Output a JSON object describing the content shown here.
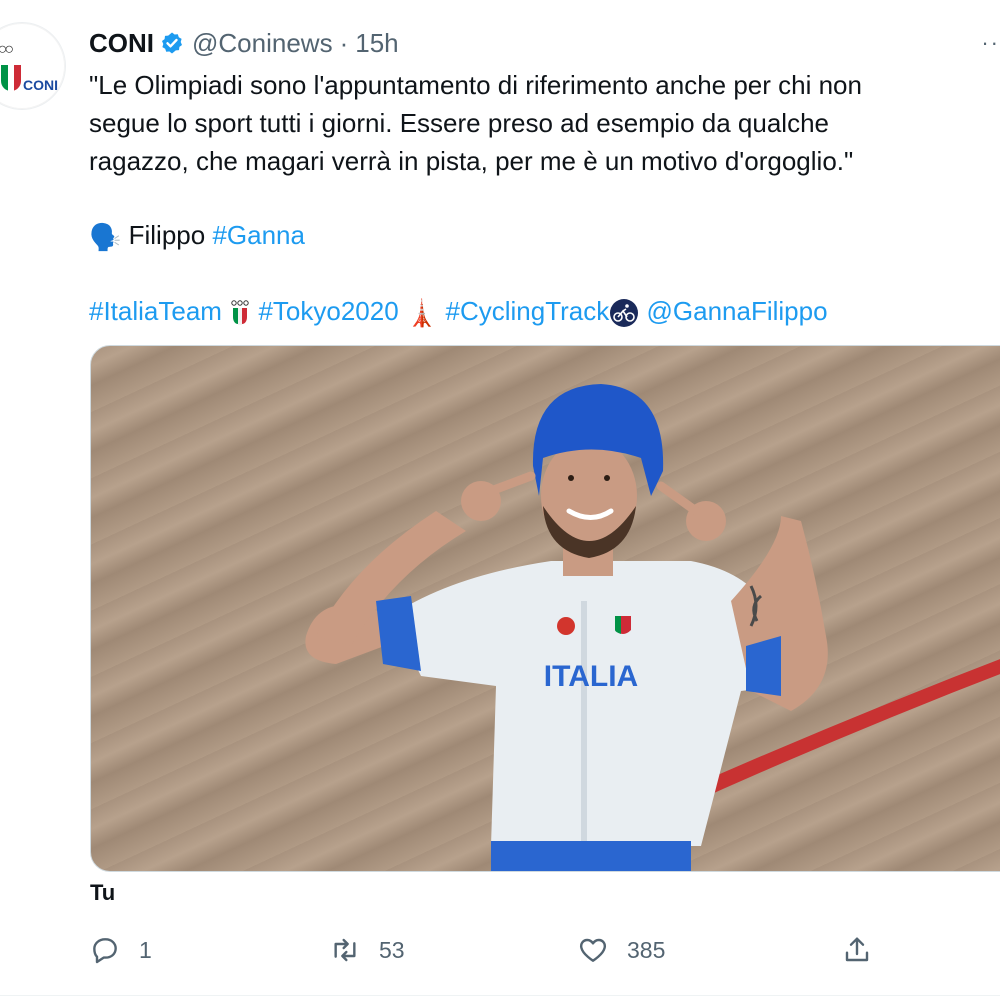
{
  "tweet": {
    "author_name": "CONI",
    "avatar_text": "CONI",
    "handle": "@Coninews",
    "separator": "·",
    "time": "15h",
    "lines": [
      "\"Le Olimpiadi sono l'appuntamento di riferimento anche per chi non",
      "segue lo sport tutti i giorni. Essere preso ad esempio da qualche",
      "ragazzo, che magari verrà in pista, per me è un motivo d'orgoglio.\""
    ],
    "speaker_emoji": "🗣️",
    "speaker_name": "Filippo",
    "speaker_tag": "#Ganna",
    "tags": {
      "italia_team": "#ItaliaTeam",
      "tokyo": "#Tokyo2020",
      "tower_emoji": "🗼",
      "cycling": "#CyclingTrack",
      "cycling_emoji": "🚴",
      "mention": "@GannaFilippo"
    },
    "jersey_text": "ITALIA",
    "tagged_user": "Tu"
  },
  "actions": {
    "reply_count": "1",
    "retweet_count": "53",
    "like_count": "385"
  },
  "colors": {
    "link": "#1d9bf0",
    "muted": "#536471",
    "verified": "#1d9bf0",
    "helmet_blue": "#1f57c9",
    "track_red": "#c83232"
  }
}
